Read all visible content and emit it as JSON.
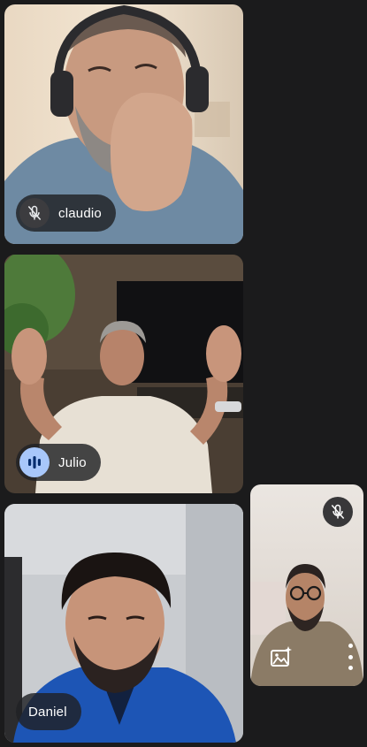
{
  "participants": [
    {
      "name": "claudio",
      "status_icon": "mic-off-icon"
    },
    {
      "name": "Julio",
      "status_icon": "speaking-indicator-icon"
    },
    {
      "name": "Daniel",
      "status_icon": ""
    }
  ],
  "self_view": {
    "status_icon": "mic-off-icon",
    "effects_icon": "visual-effects-icon",
    "more_icon": "more-options-icon"
  },
  "colors": {
    "background": "#1b1b1c",
    "pill": "#202124",
    "speaking_accent": "#a8c7fa"
  }
}
